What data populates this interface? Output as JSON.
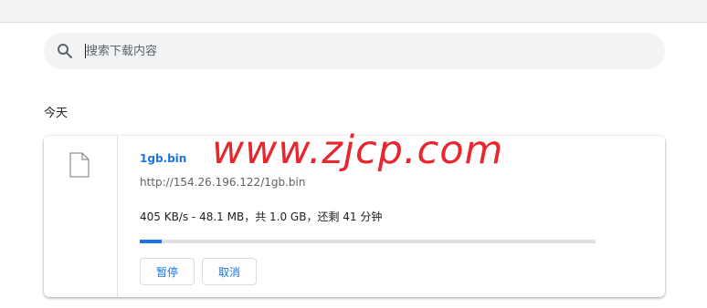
{
  "search": {
    "placeholder": "搜索下载内容"
  },
  "date_heading": "今天",
  "download": {
    "filename": "1gb.bin",
    "url": "http://154.26.196.122/1gb.bin",
    "status": "405 KB/s - 48.1 MB，共 1.0 GB，还剩 41 分钟",
    "progress": 0.048,
    "pause_label": "暂停",
    "cancel_label": "取消",
    "file_icon": "document-icon"
  },
  "watermark": "www.zjcp.com",
  "colors": {
    "accent": "#1a73e8",
    "watermark": "#e8262e"
  }
}
